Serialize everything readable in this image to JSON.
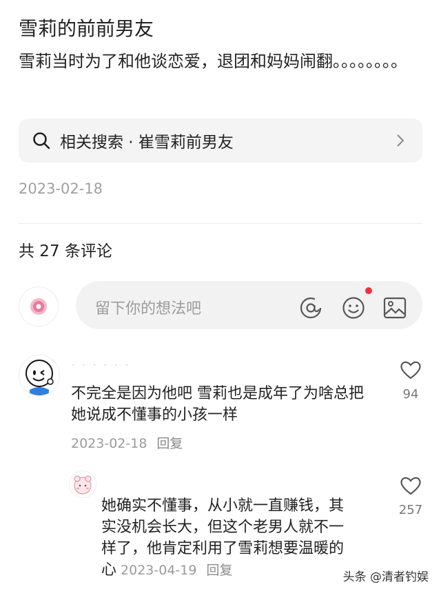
{
  "post": {
    "title": "雪莉的前前男友",
    "body": "雪莉当时为了和他谈恋爱，退团和妈妈闹翻。。。。。。。。",
    "related_search": "相关搜索 · 崔雪莉前男友",
    "date": "2023-02-18"
  },
  "comments_header": {
    "count_text": "共 27 条评论"
  },
  "comment_box": {
    "placeholder": "留下你的想法吧"
  },
  "comments": [
    {
      "username": "· · · · · ·",
      "text": "不完全是因为他吧 雪莉也是成年了为啥总把她说成不懂事的小孩一样",
      "date": "2023-02-18",
      "reply_label": "回复",
      "likes": "94"
    },
    {
      "text_lines": [
        "她确实不懂事，从小就一直赚钱，其",
        "实没机会长大，但这个老男人就不一",
        "样了，他肯定利用了雪莉想要温暖的",
        "心"
      ],
      "date": "2023-04-19",
      "reply_label": "回复",
      "likes": "257"
    }
  ],
  "watermark": "头条 @清者钓娱",
  "colors": {
    "notification_dot": "#f0313a",
    "search_bg": "#f4f4f5"
  }
}
